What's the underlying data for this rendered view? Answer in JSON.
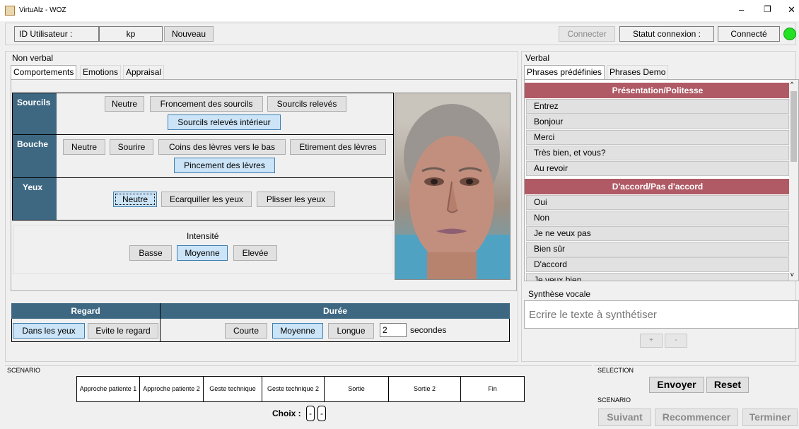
{
  "window": {
    "title": "VirtuAlz - WOZ",
    "controls": [
      "–",
      "❐",
      "✕"
    ]
  },
  "topbar": {
    "user_label": "ID Utilisateur :",
    "user_value": "kp",
    "new_button": "Nouveau",
    "connect_button": "Connecter",
    "status_label": "Statut connexion :",
    "status_value": "Connecté",
    "status_color": "#22e022"
  },
  "nonverbal": {
    "title": "Non verbal",
    "tabs": [
      "Comportements",
      "Emotions",
      "Appraisal"
    ],
    "sourcils": {
      "label": "Sourcils",
      "buttons": [
        "Neutre",
        "Froncement des sourcils",
        "Sourcils relevés",
        "Sourcils relevés intérieur"
      ]
    },
    "bouche": {
      "label": "Bouche",
      "buttons": [
        "Neutre",
        "Sourire",
        "Coins des lèvres vers le bas",
        "Etirement des lèvres",
        "Pincement des lèvres"
      ]
    },
    "yeux": {
      "label": "Yeux",
      "buttons": [
        "Neutre",
        "Ecarquiller les yeux",
        "Plisser les yeux"
      ]
    },
    "intensite": {
      "label": "Intensité",
      "buttons": [
        "Basse",
        "Moyenne",
        "Elevée"
      ]
    },
    "regard": {
      "label": "Regard",
      "buttons": [
        "Dans les yeux",
        "Evite le regard"
      ]
    },
    "duree": {
      "label": "Durée",
      "buttons": [
        "Courte",
        "Moyenne",
        "Longue"
      ],
      "seconds_value": "2",
      "seconds_label": "secondes"
    }
  },
  "verbal": {
    "title": "Verbal",
    "tabs": [
      "Phrases prédéfinies",
      "Phrases Demo"
    ],
    "categories": [
      {
        "title": "Présentation/Politesse",
        "items": [
          "Entrez",
          "Bonjour",
          "Merci",
          "Très bien, et vous?",
          "Au revoir"
        ]
      },
      {
        "title": "D'accord/Pas d'accord",
        "items": [
          "Oui",
          "Non",
          "Je ne veux pas",
          "Bien sûr",
          "D'accord",
          "Je veux bien"
        ]
      }
    ],
    "synthese": {
      "label": "Synthèse vocale",
      "placeholder": "Ecrire le texte à synthétiser",
      "plus": "+",
      "minus": "-"
    }
  },
  "scenario": {
    "label": "SCENARIO",
    "steps": [
      "Approche patiente 1",
      "Approche patiente 2",
      "Geste technique",
      "Geste technique 2",
      "Sortie",
      "Sortie 2",
      "Fin"
    ],
    "choix_label": "Choix :",
    "choix_values": [
      "-",
      "-"
    ]
  },
  "selection": {
    "label": "SELECTION",
    "send": "Envoyer",
    "reset": "Reset"
  },
  "scenario_ctrl": {
    "label": "SCENARIO",
    "next": "Suivant",
    "restart": "Recommencer",
    "finish": "Terminer"
  }
}
